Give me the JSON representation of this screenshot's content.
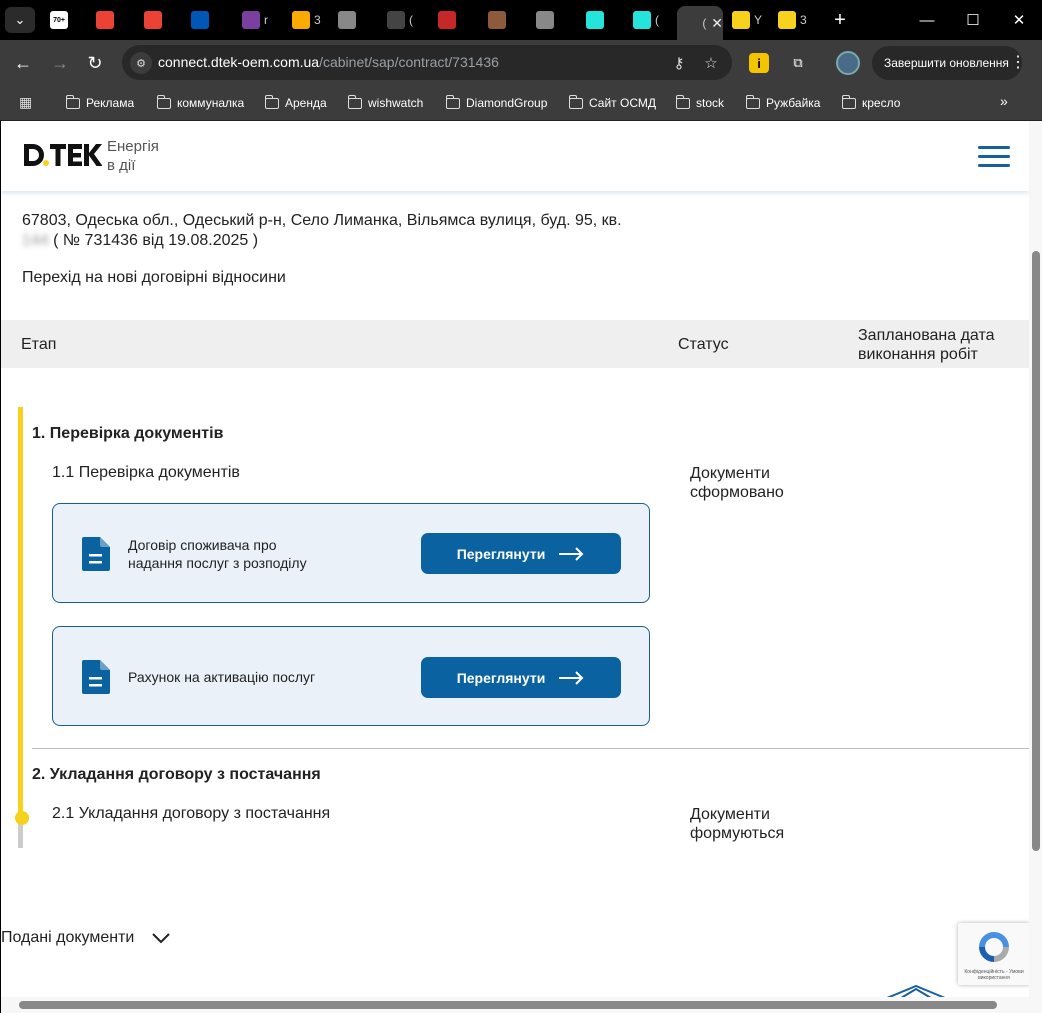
{
  "browser": {
    "tabs": [
      {
        "name": "gmail-badge",
        "label": "",
        "badge": "70+",
        "color": "#ea4335"
      },
      {
        "name": "gmail",
        "label": "",
        "color": "#ea4335"
      },
      {
        "name": "gmail",
        "label": "",
        "color": "#ea4335"
      },
      {
        "name": "ukraine-flag",
        "label": "",
        "color": "#0057b7"
      },
      {
        "name": "w-site",
        "label": "r",
        "color": "#7b3fa0"
      },
      {
        "name": "analytics",
        "label": "3",
        "color": "#f9ab00"
      },
      {
        "name": "globe",
        "label": "",
        "color": "#888888"
      },
      {
        "name": "gear-site",
        "label": "(",
        "color": "#444444"
      },
      {
        "name": "red-circle",
        "label": "",
        "color": "#c62828"
      },
      {
        "name": "ball",
        "label": "",
        "color": "#8d5a3b"
      },
      {
        "name": "globe",
        "label": "",
        "color": "#888888"
      },
      {
        "name": "olx",
        "label": "",
        "color": "#23e5db"
      },
      {
        "name": "olx",
        "label": "(",
        "color": "#23e5db"
      },
      {
        "name": "dtek-active",
        "label": "(",
        "color": "#ffffff",
        "active": true
      },
      {
        "name": "dtek",
        "label": "Y",
        "color": "#f7d21c"
      },
      {
        "name": "dtek",
        "label": "3",
        "color": "#f7d21c"
      }
    ],
    "url_host": "connect.dtek-oem.com.ua",
    "url_path": "/cabinet/sap/contract/731436",
    "update_button": "Завершити оновлення",
    "bookmarks": [
      "Реклама",
      "коммуналка",
      "Аренда",
      "wishwatch",
      "DiamondGroup",
      "Сайт ОСМД",
      "stock",
      "Ружбайка",
      "кресло"
    ]
  },
  "header": {
    "logo_text": "D.TEK",
    "slogan_line1": "Енергія",
    "slogan_line2": "в дії"
  },
  "contract": {
    "address": "67803, Одеська обл., Одеський р-н, Село Лиманка, Вільямса вулиця, буд. 95, кв.",
    "apartment_hidden": "144",
    "number_text": "( № 731436 від 19.08.2025 )",
    "subtitle": "Перехід на нові договірні відносини"
  },
  "table": {
    "col_stage": "Етап",
    "col_status": "Статус",
    "col_date_line1": "Запланована дата",
    "col_date_line2": "виконання робіт"
  },
  "stages": [
    {
      "title": "1. Перевірка документів",
      "substage": "1.1 Перевірка документів",
      "status_line1": "Документи",
      "status_line2": "сформовано",
      "documents": [
        {
          "label_line1": "Договір споживача про",
          "label_line2": "надання послуг з розподілу",
          "button": "Переглянути"
        },
        {
          "label_line1": "Рахунок на активацію послуг",
          "label_line2": "",
          "button": "Переглянути"
        }
      ]
    },
    {
      "title": "2. Укладання договору з постачання",
      "substage": "2.1 Укладання договору з постачання",
      "status_line1": "Документи",
      "status_line2": "формуються"
    }
  ],
  "submitted_docs": "Подані документи",
  "recaptcha": "Конфіденційність - Умови використання",
  "colors": {
    "brand_blue": "#0b62a1",
    "timeline_yellow": "#f7d21c",
    "card_bg": "#eaf1f8"
  }
}
